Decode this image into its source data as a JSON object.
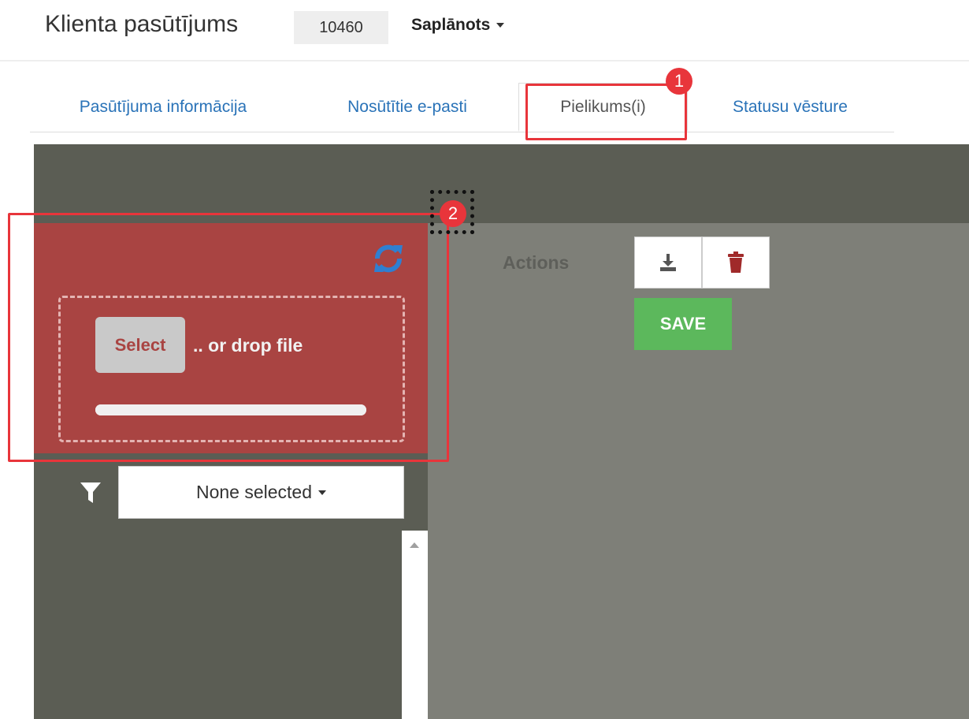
{
  "header": {
    "title": "Klienta pasūtījums",
    "order_number": "10460",
    "status": "Saplānots"
  },
  "tabs": [
    {
      "label": "Pasūtījuma informācija",
      "active": false
    },
    {
      "label": "Nosūtītie e-pasti",
      "active": false
    },
    {
      "label": "Pielikums(i)",
      "active": true
    },
    {
      "label": "Statusu vēsture",
      "active": false
    }
  ],
  "upload": {
    "refresh_icon": "refresh-icon",
    "select_label": "Select",
    "drop_text": ".. or drop file",
    "progress": 1.0
  },
  "filter": {
    "icon": "filter-icon",
    "placeholder": "None selected"
  },
  "actions": {
    "label": "Actions",
    "download_icon": "download-icon",
    "delete_icon": "trash-icon",
    "save_label": "SAVE"
  },
  "annotations": {
    "markers": [
      "1",
      "2"
    ],
    "color": "#e8353b"
  },
  "colors": {
    "upload_panel": "#a94442",
    "save_button": "#5cb85c",
    "tab_link": "#2a73b8",
    "refresh_icon": "#2f7fd1"
  }
}
